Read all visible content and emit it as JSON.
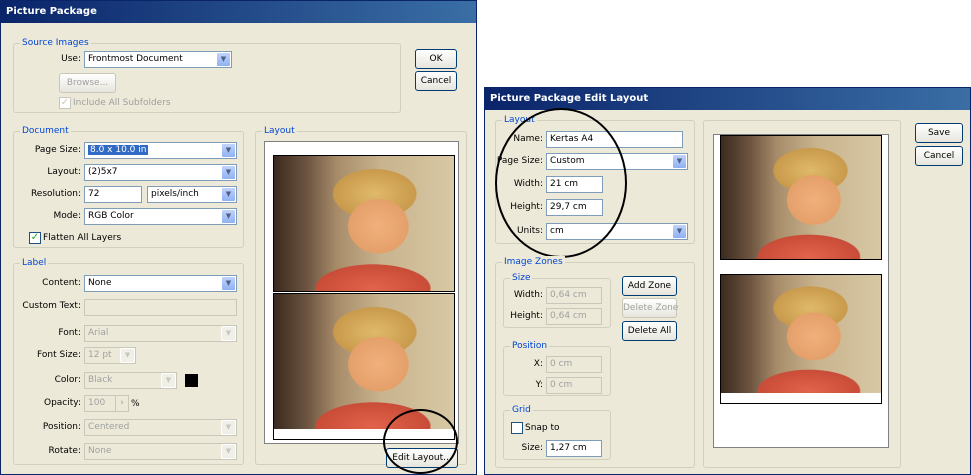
{
  "pp": {
    "title": "Picture Package",
    "source": {
      "group": "Source Images",
      "use_label": "Use:",
      "use_value": "Frontmost Document",
      "browse": "Browse...",
      "include_sub": "Include All Subfolders"
    },
    "ok": "OK",
    "cancel": "Cancel",
    "document": {
      "group": "Document",
      "page_size_label": "Page Size:",
      "page_size": "8.0 x 10.0 in",
      "layout_label": "Layout:",
      "layout": "(2)5x7",
      "resolution_label": "Resolution:",
      "resolution": "72",
      "res_unit": "pixels/inch",
      "mode_label": "Mode:",
      "mode": "RGB Color",
      "flatten": "Flatten All Layers"
    },
    "label": {
      "group": "Label",
      "content_label": "Content:",
      "content": "None",
      "custom_text_label": "Custom Text:",
      "custom_text": "",
      "font_label": "Font:",
      "font": "Arial",
      "font_size_label": "Font Size:",
      "font_size": "12 pt",
      "color_label": "Color:",
      "color": "Black",
      "opacity_label": "Opacity:",
      "opacity": "100",
      "opacity_unit": "%",
      "position_label": "Position:",
      "position": "Centered",
      "rotate_label": "Rotate:",
      "rotate": "None"
    },
    "layout_group": "Layout",
    "edit_layout": "Edit Layout..."
  },
  "pe": {
    "title": "Picture Package Edit Layout",
    "layout": {
      "group": "Layout",
      "name_label": "Name:",
      "name": "Kertas A4",
      "page_size_label": "Page Size:",
      "page_size": "Custom",
      "width_label": "Width:",
      "width": "21 cm",
      "height_label": "Height:",
      "height": "29,7 cm",
      "units_label": "Units:",
      "units": "cm"
    },
    "zones": {
      "group": "Image Zones",
      "size_group": "Size",
      "width_label": "Width:",
      "width": "0,64 cm",
      "height_label": "Height:",
      "height": "0,64 cm",
      "add": "Add Zone",
      "delete": "Delete Zone",
      "delete_all": "Delete All",
      "position_group": "Position",
      "x_label": "X:",
      "x": "0 cm",
      "y_label": "Y:",
      "y": "0 cm"
    },
    "grid": {
      "group": "Grid",
      "snap": "Snap to",
      "size_label": "Size:",
      "size": "1,27 cm"
    },
    "save": "Save",
    "cancel": "Cancel"
  }
}
